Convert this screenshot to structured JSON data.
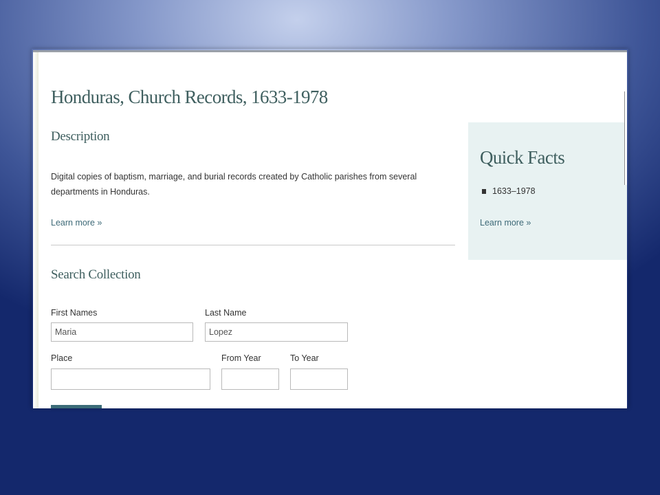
{
  "page": {
    "title": "Honduras, Church Records, 1633-1978"
  },
  "description": {
    "heading": "Description",
    "text": "Digital copies of baptism, marriage, and burial records created by Catholic parishes from several departments in Honduras.",
    "learn_more": "Learn more »"
  },
  "quick_facts": {
    "heading": "Quick Facts",
    "items": [
      "1633–1978"
    ],
    "learn_more": "Learn more »"
  },
  "search": {
    "heading": "Search Collection",
    "first_names": {
      "label": "First Names",
      "value": "Maria"
    },
    "last_name": {
      "label": "Last Name",
      "value": "Lopez"
    },
    "place": {
      "label": "Place",
      "value": ""
    },
    "from_year": {
      "label": "From Year",
      "value": ""
    },
    "to_year": {
      "label": "To Year",
      "value": ""
    }
  },
  "colors": {
    "heading": "#3f5f5f",
    "link": "#3e6a78",
    "quick_facts_bg": "#e8f2f2",
    "slide_bg_dark": "#14286c",
    "slide_bg_light": "#c4d0ec"
  }
}
